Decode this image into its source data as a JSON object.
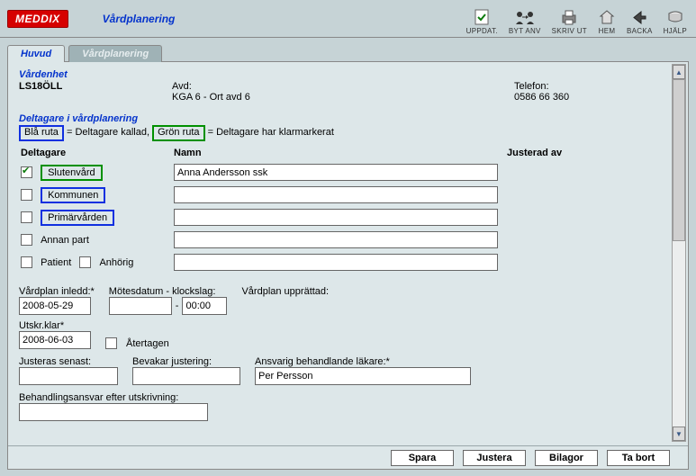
{
  "app": {
    "logo": "MEDDIX",
    "title": "Vårdplanering"
  },
  "toolbar": {
    "uppdat": "UPPDAT.",
    "byt_anv": "BYT ANV",
    "skriv_ut": "SKRIV UT",
    "hem": "HEM",
    "backa": "BACKA",
    "hjalp": "HJÄLP"
  },
  "tabs": {
    "main": "Huvud",
    "planning": "Vårdplanering"
  },
  "care_unit": {
    "heading": "Vårdenhet",
    "code": "LS18ÖLL",
    "avd_label": "Avd:",
    "avd_value": "KGA 6 - Ort avd 6",
    "tel_label": "Telefon:",
    "tel_value": "0586 66 360"
  },
  "participants": {
    "heading": "Deltagare i vårdplanering",
    "legend_blue": "Blå ruta",
    "legend_blue_desc": " = Deltagare kallad,   ",
    "legend_green": "Grön ruta",
    "legend_green_desc": " = Deltagare har klarmarkerat",
    "col_deltagare": "Deltagare",
    "col_namn": "Namn",
    "col_justerad": "Justerad av",
    "rows": {
      "slutenvard": "Slutenvård",
      "slutenvard_name": "Anna Andersson ssk",
      "kommunen": "Kommunen",
      "kommunen_name": "",
      "primarvarden": "Primärvården",
      "primarvarden_name": "",
      "annan_part": "Annan part",
      "annan_part_name": "",
      "patient": "Patient",
      "anhorig": "Anhörig",
      "patient_anhorig_name": ""
    }
  },
  "dates": {
    "vardplan_inledd_label": "Vårdplan inledd:*",
    "vardplan_inledd": "2008-05-29",
    "motesdatum_label": "Mötesdatum - klockslag:",
    "motesdatum": "",
    "klockslag": "00:00",
    "sep": "-",
    "upprattad_label": "Vårdplan upprättad:",
    "upprattad": "",
    "utskr_label": "Utskr.klar*",
    "utskr": "2008-06-03",
    "atertagen": "Återtagen",
    "justeras_senast_label": "Justeras senast:",
    "justeras_senast": "",
    "bevakar_label": "Bevakar justering:",
    "bevakar": "",
    "ansvarig_label": "Ansvarig behandlande läkare:*",
    "ansvarig": "Per Persson",
    "behandlingsansvar_label": "Behandlingsansvar efter utskrivning:",
    "behandlingsansvar": ""
  },
  "buttons": {
    "spara": "Spara",
    "justera": "Justera",
    "bilagor": "Bilagor",
    "ta_bort": "Ta bort"
  }
}
